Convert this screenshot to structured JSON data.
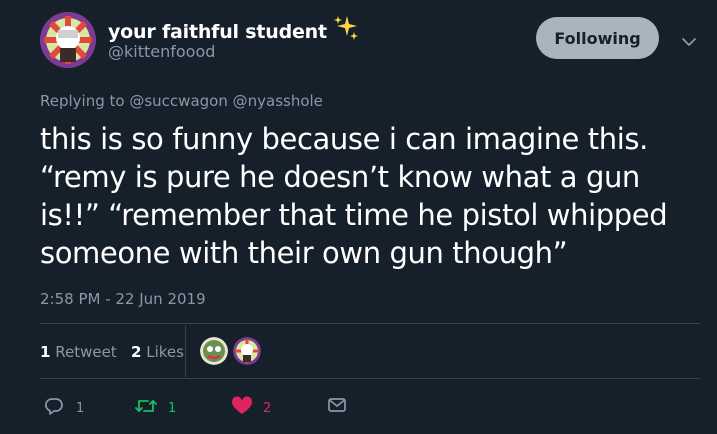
{
  "user": {
    "display_name": "your faithful student",
    "handle": "@kittenfoood"
  },
  "follow_button_label": "Following",
  "reply_context": {
    "prefix": "Replying to",
    "mentions": [
      "@succwagon",
      "@nyasshole"
    ]
  },
  "tweet": {
    "text": "this is so funny because i can imagine this. “remy is pure he doesn’t know what a gun is!!” “remember that time he pistol whipped someone with their own gun though”",
    "timestamp": "2:58 PM - 22 Jun 2019"
  },
  "stats": {
    "retweets_count": "1",
    "retweets_label": "Retweet",
    "likes_count": "2",
    "likes_label": "Likes"
  },
  "actions": {
    "reply_count": "1",
    "retweet_count": "1",
    "like_count": "2"
  },
  "colors": {
    "background": "#15202b",
    "muted_text": "#8899a6",
    "retweet_green": "#17bf63",
    "like_red": "#e0245e",
    "divider": "#38444d"
  }
}
